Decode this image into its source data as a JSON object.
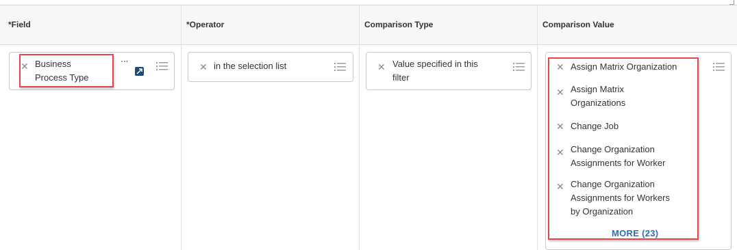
{
  "columns": {
    "field": "*Field",
    "operator": "*Operator",
    "comparison_type": "Comparison Type",
    "comparison_value": "Comparison Value"
  },
  "field": {
    "value_line1": "Business",
    "value_line2": "Process Type",
    "related_actions": "···"
  },
  "operator": {
    "value": "in the selection list"
  },
  "comparison_type": {
    "value_line1": "Value specified in this",
    "value_line2": "filter"
  },
  "comparison_value": {
    "items": [
      {
        "line1": "Assign Matrix Organization",
        "line2": "",
        "line3": ""
      },
      {
        "line1": "Assign Matrix",
        "line2": "Organizations",
        "line3": ""
      },
      {
        "line1": "Change Job",
        "line2": "",
        "line3": ""
      },
      {
        "line1": "Change Organization",
        "line2": "Assignments for Worker",
        "line3": ""
      },
      {
        "line1": "Change Organization",
        "line2": "Assignments for Workers",
        "line3": "by Organization"
      }
    ],
    "more_label": "MORE (23)"
  },
  "icons": {
    "remove": "close-icon",
    "list": "list-icon",
    "prompt": "prompt-icon"
  },
  "colors": {
    "highlight": "#e0474c",
    "link": "#2a6ebb",
    "header_bg": "#f6f7f8"
  }
}
